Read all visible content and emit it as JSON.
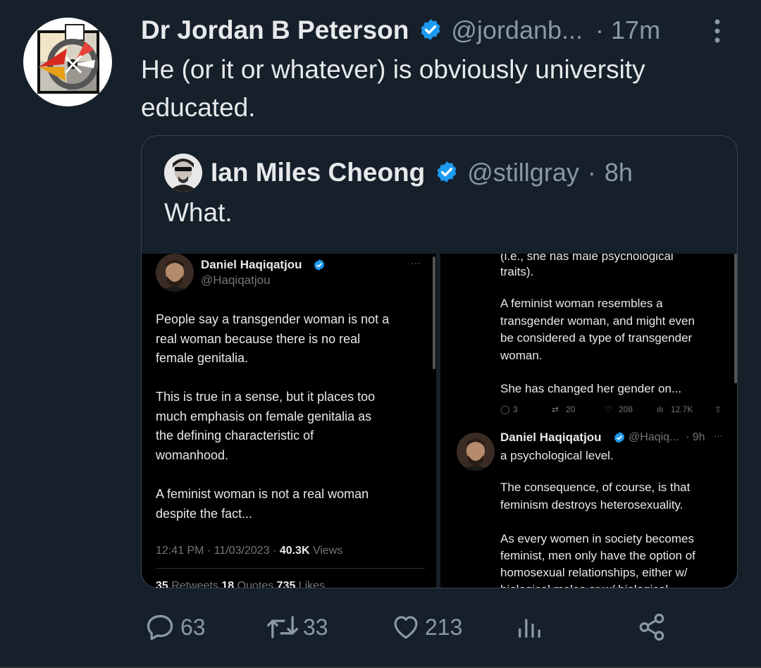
{
  "tweet": {
    "author_name": "Dr Jordan B Peterson",
    "author_handle": "@jordanb...",
    "separator": "·",
    "time": "17m",
    "text": "He (or it or whatever) is obviously university educated."
  },
  "quote": {
    "author_name": "Ian Miles Cheong",
    "author_handle": "@stillgray",
    "separator": "·",
    "time": "8h",
    "text": "What."
  },
  "screenshot": {
    "left": {
      "name": "Daniel Haqiqatjou",
      "handle": "@Haqiqatjou",
      "more": "···",
      "para1": [
        "People say a transgender woman is not a",
        "real woman because there is no real",
        "female genitalia."
      ],
      "para2": [
        "This is true in a sense, but it places too",
        "much emphasis on female genitalia as",
        "the defining characteristic of",
        "womanhood."
      ],
      "para3": [
        "A feminist woman is not a real woman",
        "despite the fact..."
      ],
      "meta_time": "12:41 PM · 11/03/2023 · ",
      "meta_views_count": "40.3K",
      "meta_views_label": " Views",
      "stats_retweets_count": "35",
      "stats_retweets_label": " Retweets  ",
      "stats_quotes_count": "18",
      "stats_quotes_label": " Quotes  ",
      "stats_likes_count": "735",
      "stats_likes_label": " Likes"
    },
    "right": {
      "top_cut": "(i.e., she has male psychological",
      "top_line2": "traits).",
      "para1": [
        "A feminist woman resembles a",
        "transgender woman, and might even",
        "be considered a type of transgender",
        "woman."
      ],
      "para2": "She has changed her gender on...",
      "stats": {
        "replies": "3",
        "retweets": "20",
        "likes": "208",
        "views": "12.7K"
      },
      "reply_name": "Daniel Haqiqatjou",
      "reply_handle": "@Haqiq...",
      "reply_time": "· 9h",
      "reply_more": "···",
      "reply_line1": "a psychological level.",
      "reply_para2": [
        "The consequence, of course, is that",
        "feminism destroys heterosexuality."
      ],
      "reply_para3": [
        "As every women in society becomes",
        "feminist, men only have the option of",
        "homosexual relationships, either w/",
        "biological males or w/ biological"
      ]
    }
  },
  "actions": {
    "replies": "63",
    "retweets": "33",
    "likes": "213"
  },
  "colors": {
    "background": "#16202b",
    "text": "#e7e9ea",
    "secondary": "#8b98a5",
    "verified": "#1d9bf0",
    "border": "#38444d"
  },
  "icons": [
    "verified-badge-icon",
    "more-icon",
    "reply-icon",
    "retweet-icon",
    "like-icon",
    "views-icon",
    "share-icon"
  ]
}
